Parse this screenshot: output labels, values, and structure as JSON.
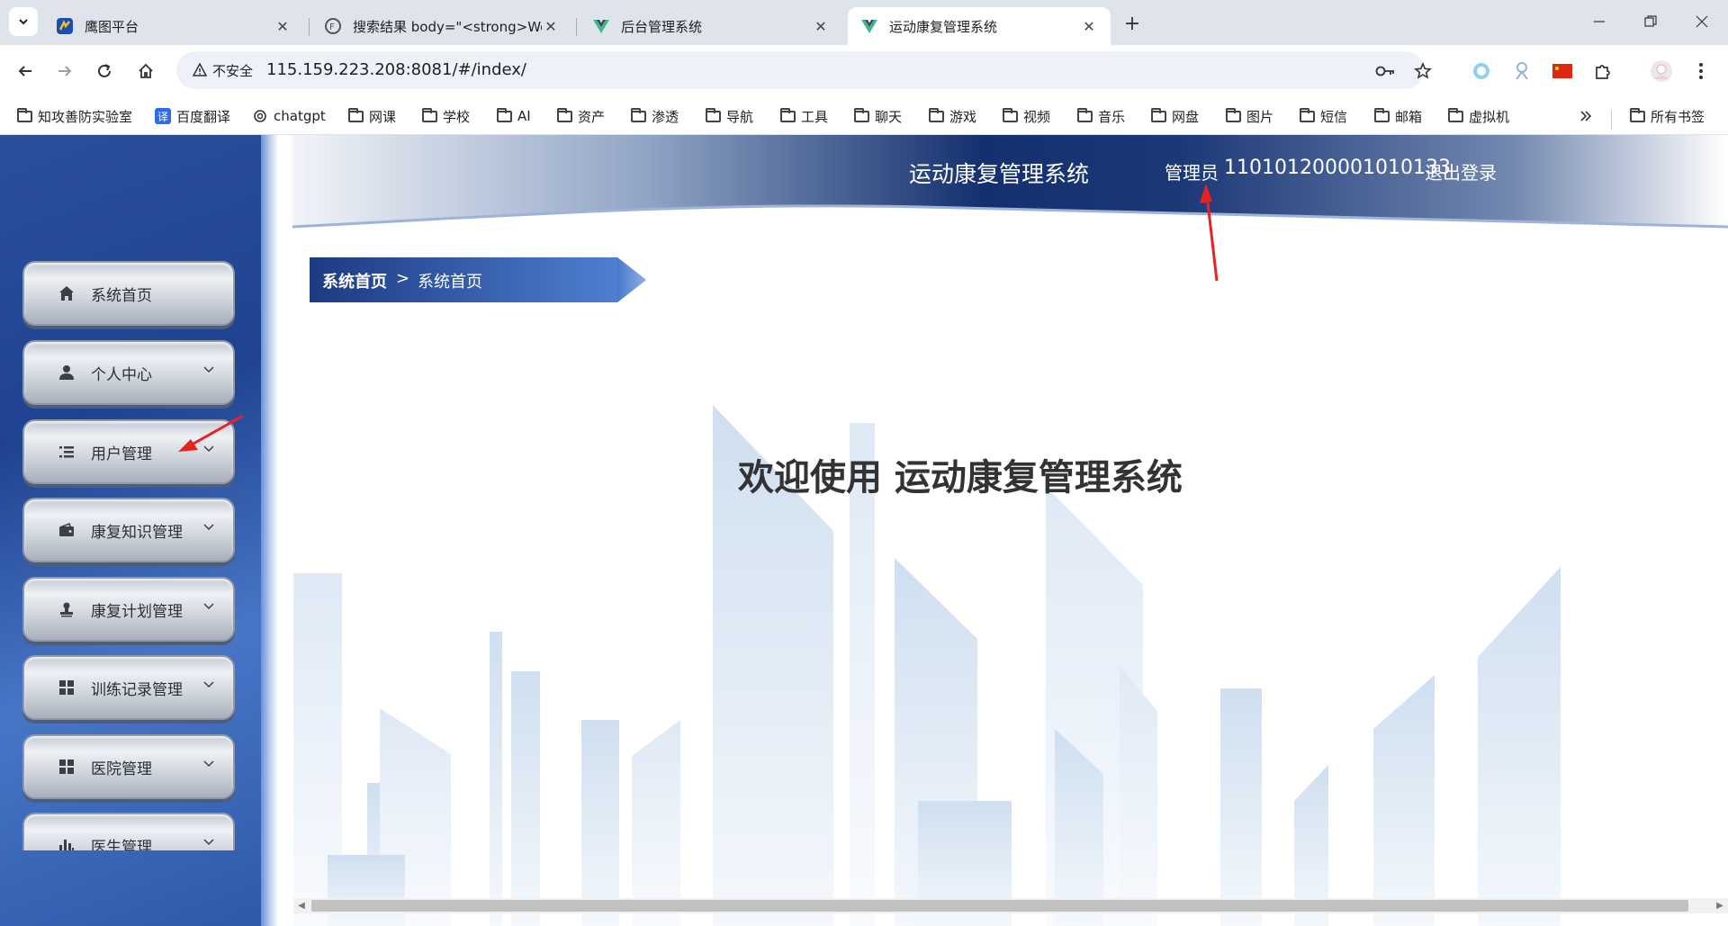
{
  "browser": {
    "tabs": [
      {
        "title": "鹰图平台",
        "icon": "hunter-icon",
        "active": false
      },
      {
        "title": "搜索结果 body=\"<strong>Welcome to",
        "icon": "fofa-icon",
        "active": false
      },
      {
        "title": "后台管理系统",
        "icon": "vue-icon",
        "active": false
      },
      {
        "title": "运动康复管理系统",
        "icon": "vue-icon",
        "active": true
      }
    ],
    "address": {
      "security_label": "不安全",
      "url": "115.159.223.208:8081/#/index/"
    },
    "bookmarks": [
      {
        "label": "知攻善防实验室",
        "icon": "folder-icon"
      },
      {
        "label": "百度翻译",
        "icon": "translate-icon"
      },
      {
        "label": "chatgpt",
        "icon": "openai-icon"
      },
      {
        "label": "网课",
        "icon": "folder-icon"
      },
      {
        "label": "学校",
        "icon": "folder-icon"
      },
      {
        "label": "AI",
        "icon": "folder-icon"
      },
      {
        "label": "资产",
        "icon": "folder-icon"
      },
      {
        "label": "渗透",
        "icon": "folder-icon"
      },
      {
        "label": "导航",
        "icon": "folder-icon"
      },
      {
        "label": "工具",
        "icon": "folder-icon"
      },
      {
        "label": "聊天",
        "icon": "folder-icon"
      },
      {
        "label": "游戏",
        "icon": "folder-icon"
      },
      {
        "label": "视频",
        "icon": "folder-icon"
      },
      {
        "label": "音乐",
        "icon": "folder-icon"
      },
      {
        "label": "网盘",
        "icon": "folder-icon"
      },
      {
        "label": "图片",
        "icon": "folder-icon"
      },
      {
        "label": "短信",
        "icon": "folder-icon"
      },
      {
        "label": "邮箱",
        "icon": "folder-icon"
      },
      {
        "label": "虚拟机",
        "icon": "folder-icon"
      }
    ],
    "all_bookmarks_label": "所有书签"
  },
  "app": {
    "header": {
      "title": "运动康复管理系统",
      "role": "管理员",
      "username": "110101200001010133",
      "logout": "退出登录"
    },
    "menu": [
      {
        "label": "系统首页",
        "icon": "home-icon",
        "has_children": false
      },
      {
        "label": "个人中心",
        "icon": "person-icon",
        "has_children": true
      },
      {
        "label": "用户管理",
        "icon": "list-icon",
        "has_children": true
      },
      {
        "label": "康复知识管理",
        "icon": "wallet-icon",
        "has_children": true
      },
      {
        "label": "康复计划管理",
        "icon": "stamp-icon",
        "has_children": true
      },
      {
        "label": "训练记录管理",
        "icon": "grid-icon",
        "has_children": true
      },
      {
        "label": "医院管理",
        "icon": "grid-icon",
        "has_children": true
      },
      {
        "label": "医生管理",
        "icon": "bar-chart-icon",
        "has_children": true
      }
    ],
    "breadcrumb": {
      "home": "系统首页",
      "separator": ">",
      "current": "系统首页"
    },
    "welcome": "欢迎使用 运动康复管理系统"
  },
  "colors": {
    "sidebar_blue": "#1f4390",
    "header_blue": "#14306e",
    "annotation_red": "#e8231f"
  }
}
